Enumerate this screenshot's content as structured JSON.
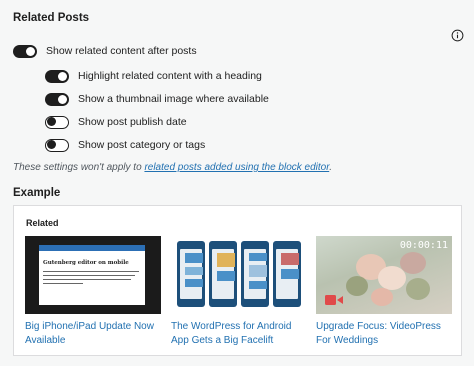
{
  "section": {
    "title": "Related Posts",
    "info_icon": "info-icon"
  },
  "toggles": [
    {
      "label": "Show related content after posts",
      "on": true
    },
    {
      "label": "Highlight related content with a heading",
      "on": true
    },
    {
      "label": "Show a thumbnail image where available",
      "on": true
    },
    {
      "label": "Show post publish date",
      "on": false
    },
    {
      "label": "Show post category or tags",
      "on": false
    }
  ],
  "note": {
    "prefix": "These settings won't apply to ",
    "link": "related posts added using the block editor",
    "suffix": "."
  },
  "example": {
    "title": "Example",
    "related_label": "Related",
    "posts": [
      {
        "title": "Big iPhone/iPad Update Now Available",
        "thumb_heading": "Gutenberg editor on mobile"
      },
      {
        "title": "The WordPress for Android App Gets a Big Facelift"
      },
      {
        "title": "Upgrade Focus: VideoPress For Weddings",
        "thumb_counter": "00:00:11"
      }
    ]
  },
  "colors": {
    "link": "#2271b1",
    "toggle_on": "#1e1e1e",
    "background": "#f6f7f7"
  }
}
